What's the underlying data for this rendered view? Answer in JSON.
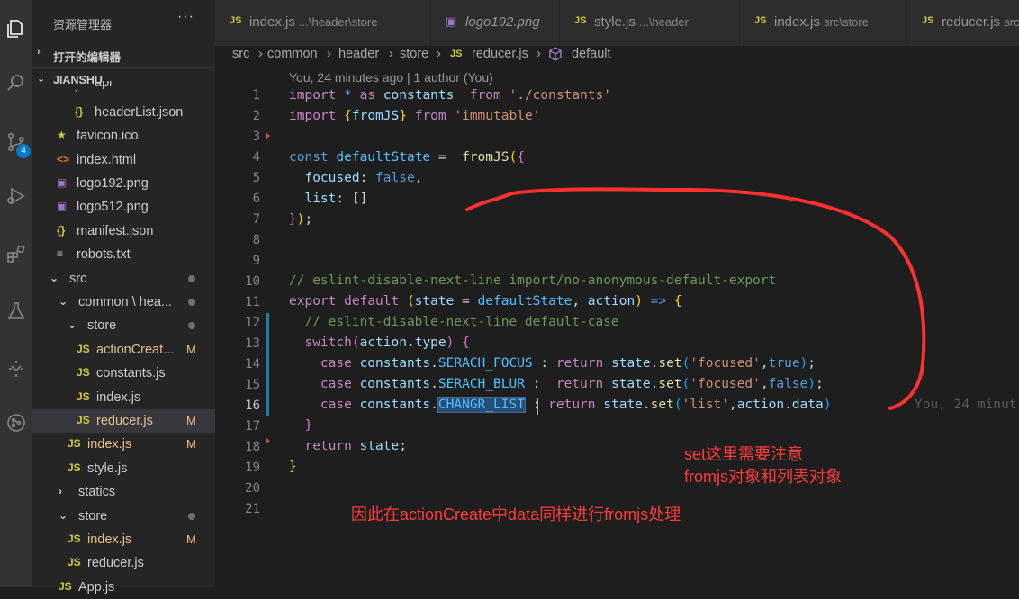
{
  "activity_bar": {
    "icons": [
      "files-icon",
      "search-icon",
      "source-control-icon",
      "run-debug-icon",
      "extensions-icon",
      "testing-icon",
      "remote-explorer-icon",
      "git-graph-icon"
    ],
    "source_control_badge": "4"
  },
  "sidebar": {
    "title": "资源管理器",
    "more": "···",
    "open_editors": "打开的编辑器",
    "project": "JIANSHU",
    "items": [
      {
        "name": "api",
        "icon": "›",
        "type": "folder-partial"
      },
      {
        "name": "headerList.json",
        "icon": "{}",
        "type": "json"
      },
      {
        "name": "favicon.ico",
        "icon": "★",
        "type": "ico"
      },
      {
        "name": "index.html",
        "icon": "<>",
        "type": "html"
      },
      {
        "name": "logo192.png",
        "icon": "▣",
        "type": "img"
      },
      {
        "name": "logo512.png",
        "icon": "▣",
        "type": "img"
      },
      {
        "name": "manifest.json",
        "icon": "{}",
        "type": "json"
      },
      {
        "name": "robots.txt",
        "icon": "≡",
        "type": "txt"
      },
      {
        "name": "src",
        "icon": "⌄",
        "type": "folder",
        "status": "dot"
      },
      {
        "name": "common \\ hea...",
        "icon": "⌄",
        "type": "folder",
        "status": "dot"
      },
      {
        "name": "store",
        "icon": "⌄",
        "type": "folder",
        "status": "dot"
      },
      {
        "name": "actionCreat...",
        "icon": "JS",
        "type": "js",
        "status": "M"
      },
      {
        "name": "constants.js",
        "icon": "JS",
        "type": "js"
      },
      {
        "name": "index.js",
        "icon": "JS",
        "type": "js"
      },
      {
        "name": "reducer.js",
        "icon": "JS",
        "type": "js",
        "status": "M"
      },
      {
        "name": "index.js",
        "icon": "JS",
        "type": "js",
        "status": "M"
      },
      {
        "name": "style.js",
        "icon": "JS",
        "type": "js"
      },
      {
        "name": "statics",
        "icon": "›",
        "type": "folder"
      },
      {
        "name": "store",
        "icon": "⌄",
        "type": "folder",
        "status": "dot"
      },
      {
        "name": "index.js",
        "icon": "JS",
        "type": "js",
        "status": "M"
      },
      {
        "name": "reducer.js",
        "icon": "JS",
        "type": "js"
      },
      {
        "name": "App.js",
        "icon": "JS",
        "type": "js"
      }
    ]
  },
  "tabs": [
    {
      "icon": "JS",
      "name": "index.js",
      "path": "...\\header\\store"
    },
    {
      "icon": "▣",
      "name": "logo192.png",
      "path": ""
    },
    {
      "icon": "JS",
      "name": "style.js",
      "path": "...\\header"
    },
    {
      "icon": "JS",
      "name": "index.js",
      "path": "src\\store"
    },
    {
      "icon": "JS",
      "name": "reducer.js",
      "path": "src"
    }
  ],
  "breadcrumb": [
    "src",
    "common",
    "header",
    "store",
    "reducer.js",
    "default"
  ],
  "codelens": "You, 24 minutes ago | 1 author (You)",
  "line_numbers": [
    "1",
    "2",
    "3",
    "4",
    "5",
    "6",
    "7",
    "8",
    "9",
    "10",
    "11",
    "12",
    "13",
    "14",
    "15",
    "16",
    "17",
    "18",
    "19",
    "20",
    "21"
  ],
  "code": {
    "l1": [
      "import",
      " * ",
      "as",
      " constants  ",
      "from",
      " './constants'"
    ],
    "l2": [
      "import",
      " {",
      "fromJS",
      "} ",
      "from",
      " 'immutable'"
    ],
    "l4": [
      "const",
      " ",
      "defaultState",
      " =  ",
      "fromJS",
      "(",
      "{"
    ],
    "l5": [
      "  focused",
      ": ",
      "false",
      ","
    ],
    "l6": [
      "  list",
      ": []"
    ],
    "l7": [
      "}",
      ")",
      ";"
    ],
    "l10": "// eslint-disable-next-line import/no-anonymous-default-export",
    "l11": [
      "export",
      " ",
      "default",
      " ",
      "(",
      "state",
      " = ",
      "defaultState",
      ", ",
      "action",
      ") ",
      "=>",
      " ",
      "{"
    ],
    "l12": "  // eslint-disable-next-line default-case",
    "l13": [
      "  ",
      "switch",
      "(",
      "action",
      ".",
      "type",
      ") ",
      "{"
    ],
    "l14": [
      "    ",
      "case",
      " ",
      "constants",
      ".",
      "SERACH_FOCUS",
      " : ",
      "return",
      " ",
      "state",
      ".",
      "set",
      "(",
      "'focused'",
      ",",
      "true",
      ")",
      ";"
    ],
    "l15": [
      "    ",
      "case",
      " ",
      "constants",
      ".",
      "SERACH_BLUR",
      " :  ",
      "return",
      " ",
      "state",
      ".",
      "set",
      "(",
      "'focused'",
      ",",
      "false",
      ")",
      ";"
    ],
    "l16": [
      "    ",
      "case",
      " ",
      "constants",
      ".",
      "CHANGR_LIST",
      " : ",
      "return",
      " ",
      "state",
      ".",
      "set",
      "(",
      "'list'",
      ",",
      "action",
      ".",
      "data",
      ")"
    ],
    "l17": [
      "  ",
      "}"
    ],
    "l18": [
      "  ",
      "return",
      " ",
      "state",
      ";"
    ],
    "l19": [
      "}"
    ]
  },
  "blame_l16": "You, 24 minut",
  "annotations": {
    "note1_line1": "set这里需要注意",
    "note1_line2": "fromjs对象和列表对象",
    "note2": "因此在actionCreate中data同样进行fromjs处理"
  }
}
